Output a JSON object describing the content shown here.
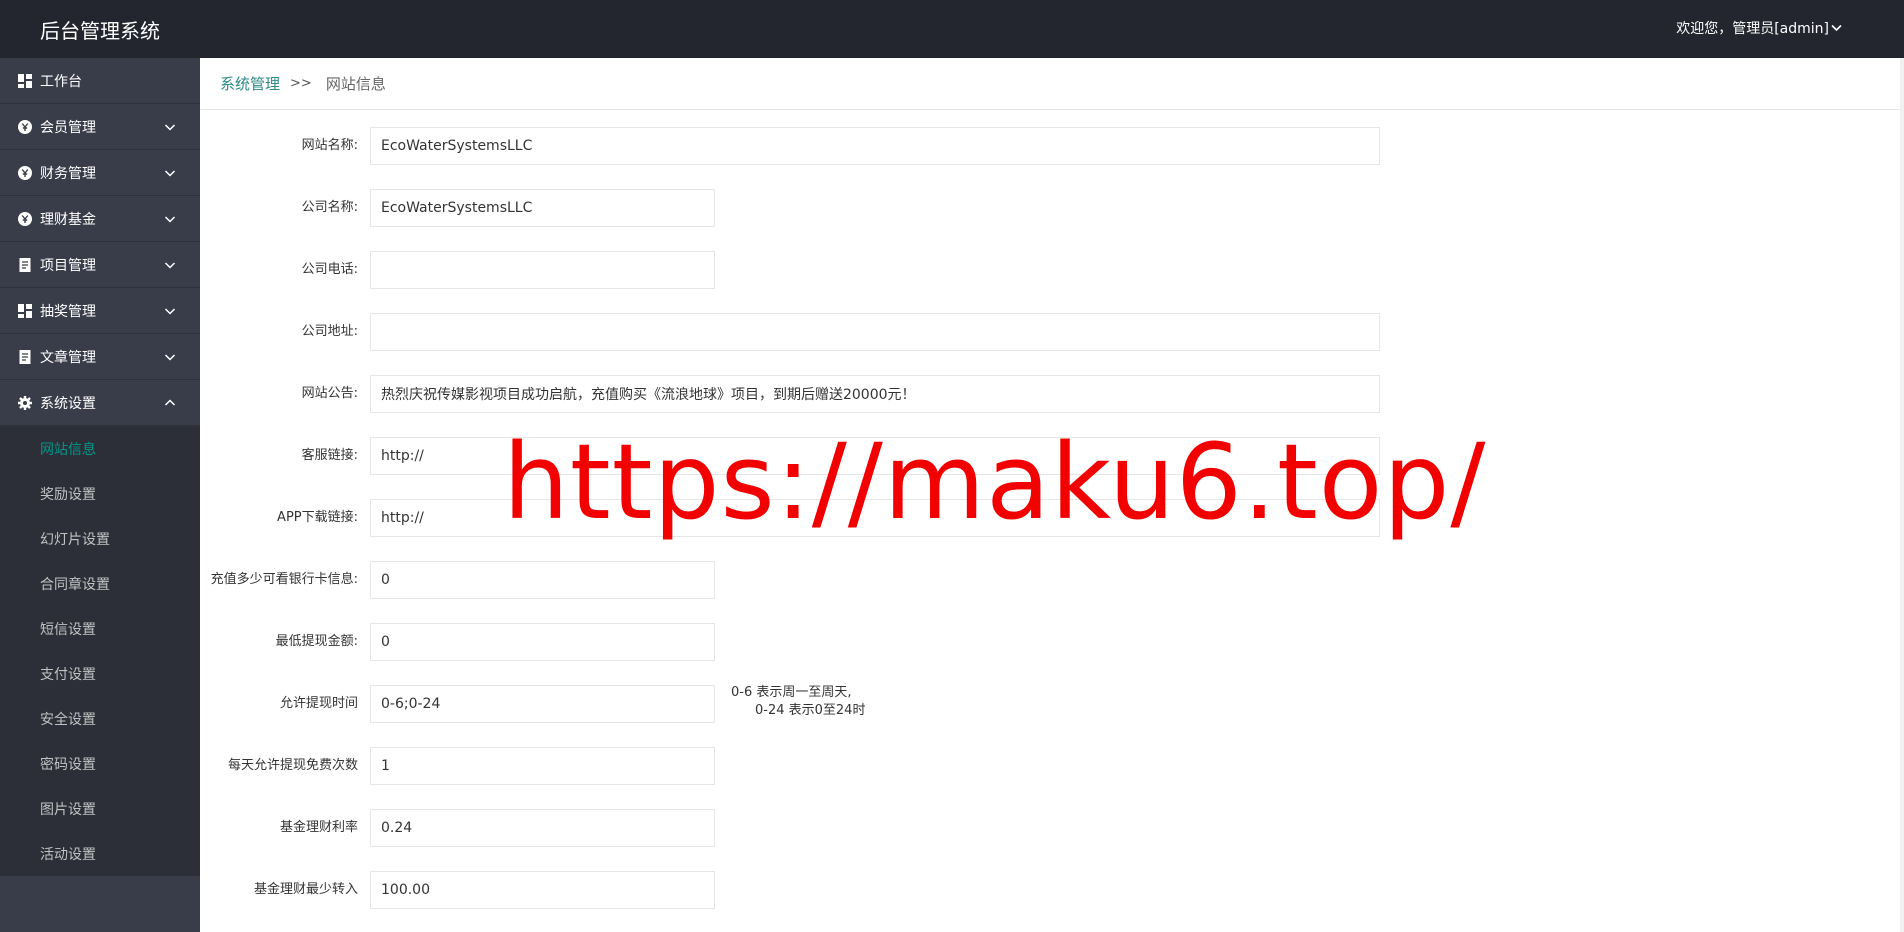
{
  "header": {
    "title": "后台管理系统",
    "user_greeting": "欢迎您，管理员[admin]"
  },
  "sidebar": {
    "items": [
      {
        "label": "工作台",
        "icon": "dashboard-icon"
      },
      {
        "label": "会员管理",
        "icon": "yen-circle-icon"
      },
      {
        "label": "财务管理",
        "icon": "yen-circle-icon"
      },
      {
        "label": "理财基金",
        "icon": "yen-circle-icon"
      },
      {
        "label": "项目管理",
        "icon": "document-icon"
      },
      {
        "label": "抽奖管理",
        "icon": "dashboard-icon"
      },
      {
        "label": "文章管理",
        "icon": "document-icon"
      },
      {
        "label": "系统设置",
        "icon": "gear-icon"
      }
    ],
    "sub_items": [
      {
        "label": "网站信息"
      },
      {
        "label": "奖励设置"
      },
      {
        "label": "幻灯片设置"
      },
      {
        "label": "合同章设置"
      },
      {
        "label": "短信设置"
      },
      {
        "label": "支付设置"
      },
      {
        "label": "安全设置"
      },
      {
        "label": "密码设置"
      },
      {
        "label": "图片设置"
      },
      {
        "label": "活动设置"
      }
    ],
    "active_sub": "网站信息"
  },
  "breadcrumb": {
    "parent": "系统管理",
    "separator": ">>",
    "current": "网站信息"
  },
  "form": {
    "fields": [
      {
        "label": "网站名称:",
        "value": "EcoWaterSystemsLLC"
      },
      {
        "label": "公司名称:",
        "value": "EcoWaterSystemsLLC"
      },
      {
        "label": "公司电话:",
        "value": ""
      },
      {
        "label": "公司地址:",
        "value": ""
      },
      {
        "label": "网站公告:",
        "value": "热烈庆祝传媒影视项目成功启航，充值购买《流浪地球》项目，到期后赠送20000元！"
      },
      {
        "label": "客服链接:",
        "value": "http://"
      },
      {
        "label": "APP下载链接:",
        "value": "http://"
      },
      {
        "label": "充值多少可看银行卡信息:",
        "value": "0"
      },
      {
        "label": "最低提现金额:",
        "value": "0"
      },
      {
        "label": "允许提现时间",
        "value": "0-6;0-24"
      },
      {
        "label": "每天允许提现免费次数",
        "value": "1"
      },
      {
        "label": "基金理财利率",
        "value": "0.24"
      },
      {
        "label": "基金理财最少转入",
        "value": "100.00"
      }
    ],
    "withdraw_hint_line1": "0-6 表示周一至周天,",
    "withdraw_hint_line2": "0-24 表示0至24时"
  },
  "watermark": "https://maku6.top/",
  "colors": {
    "header_bg": "#23262e",
    "sidebar_bg": "#393d49",
    "submenu_bg": "#2c2f38",
    "accent": "#009688",
    "watermark": "#f20000"
  }
}
